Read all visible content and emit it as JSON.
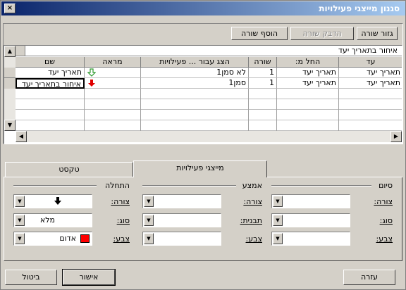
{
  "window": {
    "title": "סגנון מייצגי פעילויות",
    "close_glyph": "×"
  },
  "toolbar": {
    "cut_row": "גזור שורה",
    "paste_row": "הדבק שורה",
    "insert_row": "הוסף שורה"
  },
  "grid": {
    "edit_value": "איחור בתאריך יעד",
    "columns": [
      "שם",
      "מראה",
      "הצג עבור ... פעילויות",
      "שורה",
      "החל מ:",
      "עד"
    ],
    "rows": [
      {
        "name": "תאריך יעד",
        "appearance_icon": "green-down-arrow-icon",
        "show_for": "לא סמן1",
        "row": "1",
        "from": "תאריך יעד",
        "to": "תאריך יעד"
      },
      {
        "name": "איחור בתאריך יעד",
        "appearance_icon": "red-down-arrow-icon",
        "show_for": "סמן1",
        "row": "1",
        "from": "תאריך יעד",
        "to": "תאריך יעד"
      }
    ]
  },
  "tabs": {
    "bars": "מייצגי פעילויות",
    "text": "טקסט"
  },
  "sections": {
    "start": {
      "title": "התחלה",
      "shape_label": "צורה:",
      "type_label": "סוג:",
      "color_label": "צבע:",
      "shape_value_icon": "black-down-arrow-icon",
      "type_value": "מלא",
      "color_value": "אדום",
      "color_swatch": "#ff0000"
    },
    "middle": {
      "title": "אמצע",
      "shape_label": "צורה:",
      "pattern_label": "תבנית:",
      "color_label": "צבע:"
    },
    "end": {
      "title": "סיום",
      "shape_label": "צורה:",
      "type_label": "סוג:",
      "color_label": "צבע:"
    }
  },
  "footer": {
    "help": "עזרה",
    "ok": "אישור",
    "cancel": "ביטול"
  }
}
